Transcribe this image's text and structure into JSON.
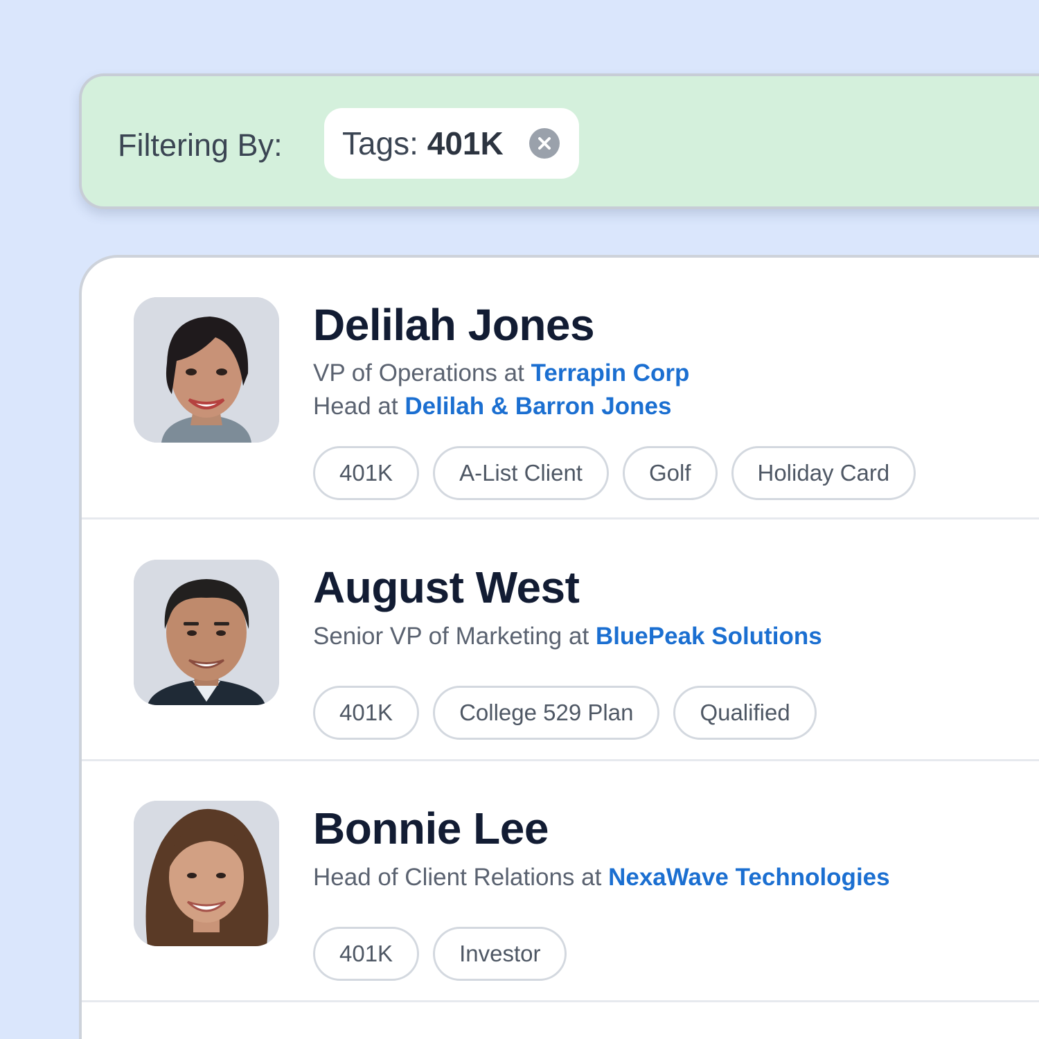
{
  "filter": {
    "label": "Filtering By:",
    "chip_key": "Tags:",
    "chip_value": "401K"
  },
  "contacts": [
    {
      "name": "Delilah Jones",
      "roles": [
        {
          "title": "VP of Operations at",
          "company": "Terrapin Corp"
        },
        {
          "title": "Head at",
          "company": "Delilah & Barron Jones"
        }
      ],
      "tags": [
        "401K",
        "A-List Client",
        "Golf",
        "Holiday Card"
      ]
    },
    {
      "name": "August West",
      "roles": [
        {
          "title": "Senior VP of Marketing at",
          "company": "BluePeak Solutions"
        }
      ],
      "tags": [
        "401K",
        "College 529 Plan",
        "Qualified"
      ]
    },
    {
      "name": "Bonnie Lee",
      "roles": [
        {
          "title": "Head of Client Relations at",
          "company": "NexaWave Technologies"
        }
      ],
      "tags": [
        "401K",
        "Investor"
      ]
    }
  ],
  "colors": {
    "page_background": "#dae6fc",
    "filter_bar_background": "#d4f0dc",
    "link": "#1b6fd1",
    "name": "#121c33",
    "muted_text": "#5a6270"
  },
  "icons": {
    "chip_close": "close-circle-icon"
  }
}
